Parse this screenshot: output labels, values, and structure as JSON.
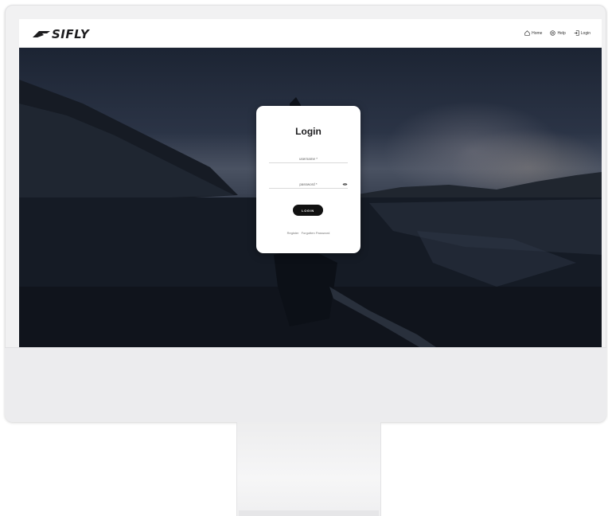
{
  "brand": {
    "logo_text": "SIFLY"
  },
  "nav": {
    "items": [
      {
        "label": "Home",
        "icon": "home-icon"
      },
      {
        "label": "Help",
        "icon": "help-icon"
      },
      {
        "label": "Login",
        "icon": "login-icon"
      }
    ]
  },
  "login": {
    "title": "Login",
    "username_label": "username *",
    "password_label": "password *",
    "submit_label": "LOGIN",
    "register_link": "Register",
    "forgotten_link": "Forgotten Password"
  },
  "colors": {
    "card_bg": "#ffffff",
    "button_bg": "#111111",
    "device_body": "#f1f1f2"
  }
}
